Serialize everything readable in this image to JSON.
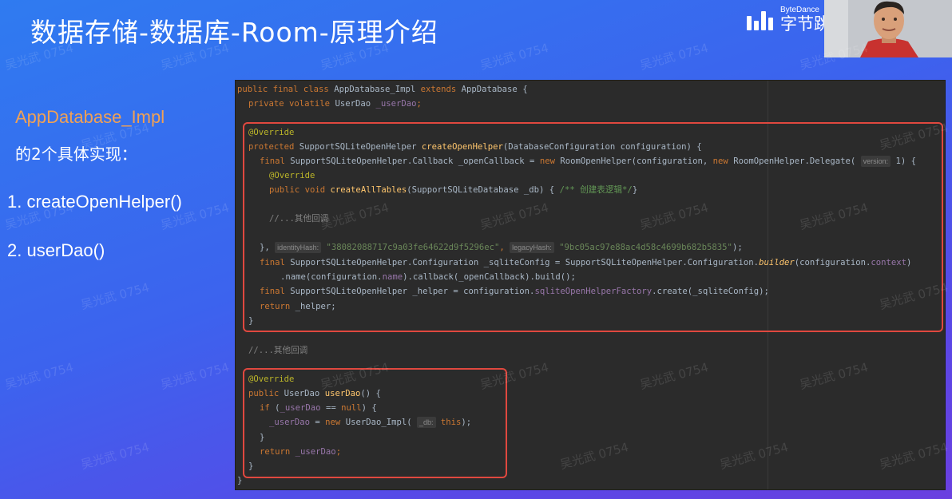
{
  "slide": {
    "title": "数据存储-数据库-Room-原理介绍",
    "logo_en": "ByteDance",
    "logo_cn": "字节跳",
    "watermark": "吴光武 0754"
  },
  "left": {
    "subhead": "AppDatabase_Impl",
    "subhead2": "的2个具体实现：",
    "items": [
      "1. createOpenHelper()",
      "2. userDao()"
    ]
  },
  "code": {
    "l1_kw": "public final class ",
    "l1_name": "AppDatabase_Impl ",
    "l1_ext": "extends ",
    "l1_base": "AppDatabase {",
    "l2_kw": "private volatile ",
    "l2_type": "UserDao ",
    "l2_field": "_userDao",
    "l2_semi": ";",
    "override": "@Override",
    "l4_kw": "protected ",
    "l4_type": "SupportSQLiteOpenHelper ",
    "l4_fn": "createOpenHelper",
    "l4_rest": "(DatabaseConfiguration configuration) {",
    "l5_kw": "final ",
    "l5_a": "SupportSQLiteOpenHelper.Callback _openCallback = ",
    "l5_new": "new ",
    "l5_b": "RoomOpenHelper(configuration, ",
    "l5_new2": "new ",
    "l5_c": "RoomOpenHelper.Delegate( ",
    "l5_hint": "version:",
    "l5_d": " 1) {",
    "l7_kw": "public void ",
    "l7_fn": "createAllTables",
    "l7_rest": "(SupportSQLiteDatabase _db) { ",
    "l7_cm": "/** 创建表逻辑*/",
    "l7_end": "}",
    "l9": "//...其他回调",
    "l11_a": "}, ",
    "l11_h1": "identityHash:",
    "l11_s1": " \"38082088717c9a03fe64622d9f5296ec\"",
    "l11_b": ", ",
    "l11_h2": "legacyHash:",
    "l11_s2": " \"9bc05ac97e88ac4d58c4699b682b5835\"",
    "l11_c": ");",
    "l12_kw": "final ",
    "l12_a": "SupportSQLiteOpenHelper.Configuration _sqliteConfig = SupportSQLiteOpenHelper.Configuration.",
    "l12_fn": "builder",
    "l12_b": "(configuration.",
    "l12_fld": "context",
    "l12_c": ")",
    "l13_a": ".name(configuration.",
    "l13_fld": "name",
    "l13_b": ").callback(_openCallback).build();",
    "l14_kw": "final ",
    "l14_a": "SupportSQLiteOpenHelper _helper = configuration.",
    "l14_fld": "sqliteOpenHelperFactory",
    "l14_b": ".create(_sqliteConfig);",
    "l15_kw": "return ",
    "l15_a": "_helper;",
    "close": "}",
    "l18": "//...其他回调",
    "l21_kw": "public ",
    "l21_type": "UserDao ",
    "l21_fn": "userDao",
    "l21_rest": "() {",
    "l22_kw": "if ",
    "l22_a": "(",
    "l22_fld": "_userDao",
    "l22_b": " == ",
    "l22_null": "null",
    "l22_c": ") {",
    "l23_fld": "_userDao",
    "l23_a": " = ",
    "l23_new": "new ",
    "l23_b": "UserDao_Impl( ",
    "l23_hint": "_db:",
    "l23_this": " this",
    "l23_c": ");",
    "l25_kw": "return ",
    "l25_fld": "_userDao",
    "l25_semi": ";"
  },
  "colors": {
    "background_start": "#2f7bf0",
    "background_end": "#6a3fe0",
    "accent_orange": "#f0a155",
    "highlight_red": "#e0483f",
    "editor_bg": "#2b2b2b"
  }
}
